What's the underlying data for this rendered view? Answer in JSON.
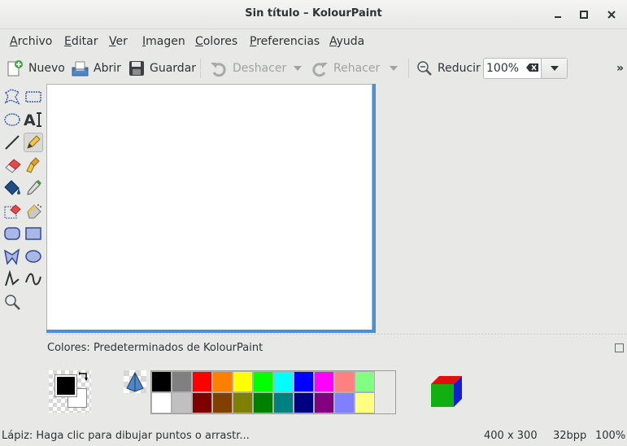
{
  "window": {
    "title": "Sin título – KolourPaint"
  },
  "menubar": {
    "items": [
      {
        "pre": "",
        "u": "A",
        "post": "rchivo"
      },
      {
        "pre": "",
        "u": "E",
        "post": "ditar"
      },
      {
        "pre": "",
        "u": "V",
        "post": "er"
      },
      {
        "pre": "",
        "u": "I",
        "post": "magen"
      },
      {
        "pre": "",
        "u": "C",
        "post": "olores"
      },
      {
        "pre": "",
        "u": "P",
        "post": "referencias"
      },
      {
        "pre": "",
        "u": "A",
        "post": "yuda"
      }
    ]
  },
  "toolbar": {
    "new_label": "Nuevo",
    "open_label": "Abrir",
    "save_label": "Guardar",
    "undo_label": "Deshacer",
    "redo_label": "Rehacer",
    "zoom_out_label": "Reducir",
    "zoom_value": "100%",
    "overflow": "»"
  },
  "colors_panel": {
    "label": "Colores: Predeterminados de KolourPaint",
    "foreground": "#000000",
    "background": "#ffffff",
    "palette_row1": [
      "#000000",
      "#808080",
      "#ff0000",
      "#ff8000",
      "#ffff00",
      "#00ff00",
      "#00ffff",
      "#0000ff",
      "#ff00ff",
      "#ff8080",
      "#80ff80"
    ],
    "palette_row2": [
      "#ffffff",
      "#c0c0c0",
      "#800000",
      "#804000",
      "#808000",
      "#008000",
      "#008080",
      "#000080",
      "#800080",
      "#8080ff",
      "#ffff80"
    ]
  },
  "statusbar": {
    "message": "Lápiz: Haga clic para dibujar puntos o arrastr...",
    "image_size": "400 x 300",
    "bpp": "32bpp",
    "zoom": "100%"
  }
}
